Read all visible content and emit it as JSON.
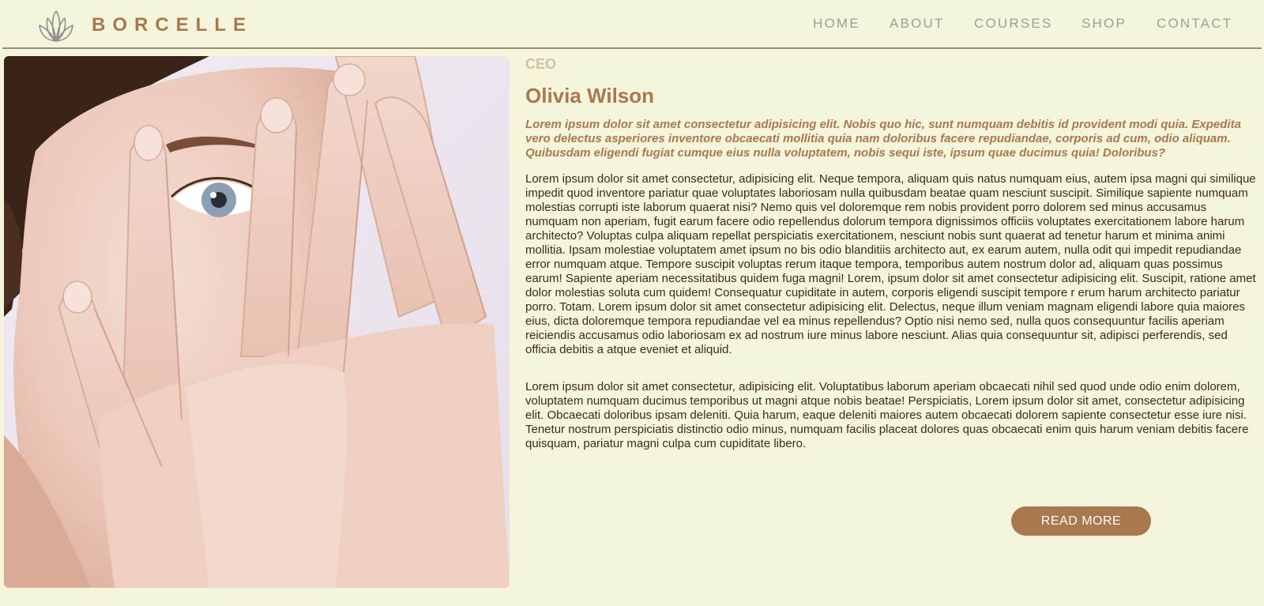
{
  "brand": {
    "name": "BORCELLE",
    "logo_icon": "lotus-icon"
  },
  "nav": {
    "items": [
      {
        "label": "HOME"
      },
      {
        "label": "ABOUT"
      },
      {
        "label": "COURSES"
      },
      {
        "label": "SHOP"
      },
      {
        "label": "CONTACT"
      }
    ]
  },
  "profile": {
    "role": "CEO",
    "name": "Olivia Wilson",
    "lead": "Lorem ipsum dolor sit amet consectetur adipisicing elit. Nobis quo hic, sunt numquam debitis id provident modi quia. Expedita vero delectus asperiores inventore obcaecati mollitia quia nam doloribus facere repudiandae, corporis ad cum, odio aliquam. Quibusdam eligendi fugiat cumque eius nulla voluptatem, nobis sequi iste, ipsum quae ducimus quia! Doloribus?",
    "paragraph_1": "Lorem ipsum dolor sit amet consectetur, adipisicing elit. Neque tempora, aliquam quis natus numquam eius, autem ipsa magni qui similique impedit quod inventore pariatur quae voluptates laboriosam nulla quibusdam beatae quam nesciunt suscipit. Similique sapiente numquam molestias corrupti iste laborum quaerat nisi? Nemo quis vel doloremque rem nobis provident porro dolorem sed minus accusamus numquam non aperiam, fugit earum facere odio repellendus dolorum tempora dignissimos officiis voluptates exercitationem labore harum architecto? Voluptas culpa aliquam repellat perspiciatis exercitationem, nesciunt nobis sunt quaerat ad tenetur harum et minima animi mollitia. Ipsam molestiae voluptatem amet ipsum no bis odio blanditiis architecto aut, ex earum autem, nulla odit qui impedit repudiandae error numquam atque. Tempore suscipit voluptas rerum itaque tempora, temporibus autem nostrum dolor ad, aliquam quas possimus earum! Sapiente aperiam necessitatibus quidem fuga magni! Lorem, ipsum dolor sit amet consectetur adipisicing elit. Suscipit, ratione amet dolor molestias soluta cum quidem! Consequatur cupiditate in autem, corporis eligendi suscipit tempore r erum harum architecto pariatur porro. Totam. Lorem ipsum dolor sit amet consectetur adipisicing elit. Delectus, neque illum veniam magnam eligendi labore quia maiores eius, dicta doloremque tempora repudiandae vel ea minus repellendus? Optio nisi nemo sed, nulla quos consequuntur facilis aperiam reiciendis accusamus odio laboriosam ex ad nostrum iure minus labore nesciunt. Alias quia consequuntur sit, adipisci perferendis, sed officia debitis a atque eveniet et aliquid.",
    "paragraph_2": "Lorem ipsum dolor sit amet consectetur, adipisicing elit. Voluptatibus laborum aperiam obcaecati nihil sed quod unde odio enim dolorem, voluptatem numquam ducimus temporibus ut magni atque nobis beatae! Perspiciatis, Lorem ipsum dolor sit amet, consectetur adipisicing elit. Obcaecati doloribus ipsam deleniti. Quia harum, eaque deleniti maiores autem obcaecati dolorem sapiente consectetur esse iure nisi. Tenetur nostrum perspiciatis distinctio odio minus, numquam facilis placeat dolores quas obcaecati enim quis harum veniam debitis facere quisquam, pariatur magni culpa cum cupiditate libero.",
    "cta_label": "READ MORE",
    "photo_icon": "portrait-photo"
  },
  "colors": {
    "background": "#f5f5dc",
    "accent": "#a9784f",
    "nav_text": "#9d9d9d",
    "role_text": "#d2bfa9",
    "body_text": "#3c2a1e"
  }
}
